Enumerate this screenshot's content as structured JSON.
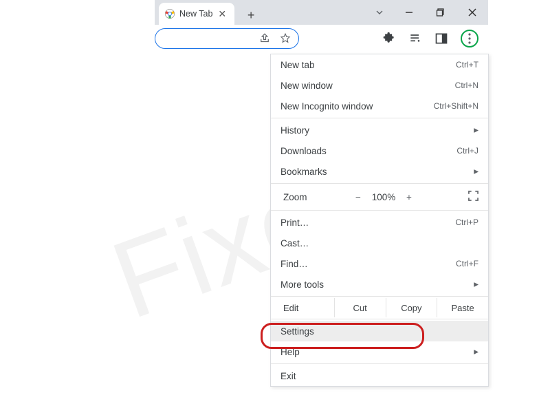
{
  "watermark": "Fixotip",
  "tab": {
    "title": "New Tab"
  },
  "menu": {
    "new_tab": {
      "label": "New tab",
      "shortcut": "Ctrl+T"
    },
    "new_window": {
      "label": "New window",
      "shortcut": "Ctrl+N"
    },
    "new_incognito": {
      "label": "New Incognito window",
      "shortcut": "Ctrl+Shift+N"
    },
    "history": {
      "label": "History"
    },
    "downloads": {
      "label": "Downloads",
      "shortcut": "Ctrl+J"
    },
    "bookmarks": {
      "label": "Bookmarks"
    },
    "zoom": {
      "label": "Zoom",
      "minus": "−",
      "value": "100%",
      "plus": "+"
    },
    "print": {
      "label": "Print…",
      "shortcut": "Ctrl+P"
    },
    "cast": {
      "label": "Cast…"
    },
    "find": {
      "label": "Find…",
      "shortcut": "Ctrl+F"
    },
    "more_tools": {
      "label": "More tools"
    },
    "edit": {
      "label": "Edit",
      "cut": "Cut",
      "copy": "Copy",
      "paste": "Paste"
    },
    "settings": {
      "label": "Settings"
    },
    "help": {
      "label": "Help"
    },
    "exit": {
      "label": "Exit"
    }
  }
}
